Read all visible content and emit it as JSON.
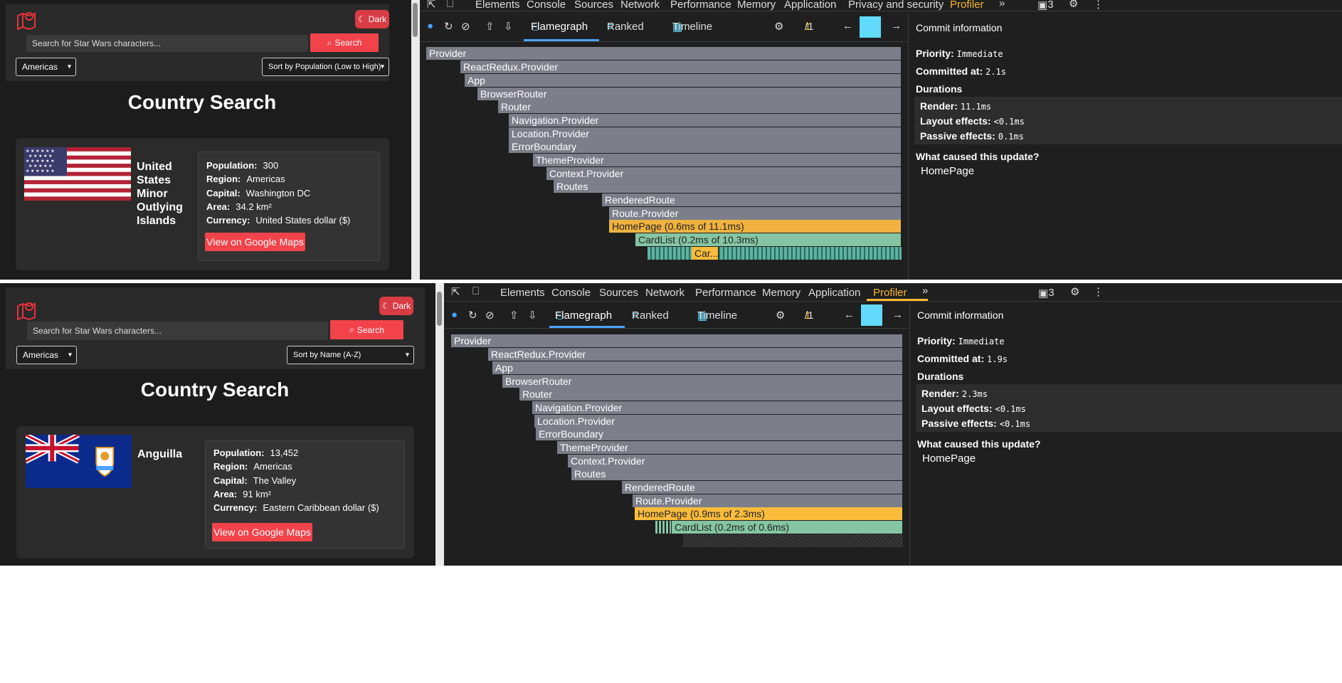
{
  "shots": [
    {
      "app": {
        "dark_label": "Dark",
        "search_placeholder": "Search for Star Wars characters...",
        "search_label": "Search",
        "region_value": "Americas",
        "sort_value": "Sort by Population (Low to High)",
        "title": "Country Search",
        "country": {
          "name": "United States Minor Outlying Islands",
          "name_lines": [
            "United",
            "States",
            "Minor",
            "Outlying",
            "Islands"
          ],
          "flag": "us-flag",
          "fields": [
            {
              "label": "Population:",
              "value": "300"
            },
            {
              "label": "Region:",
              "value": "Americas"
            },
            {
              "label": "Capital:",
              "value": "Washington DC"
            },
            {
              "label": "Area:",
              "value": "34.2 km²"
            },
            {
              "label": "Currency:",
              "value": "United States dollar ($)"
            }
          ],
          "maps_label": "View on Google Maps"
        }
      },
      "devtools": {
        "tabs": [
          "Elements",
          "Console",
          "Sources",
          "Network",
          "Performance",
          "Memory",
          "Application",
          "Privacy and security",
          "Profiler"
        ],
        "active_tab": "Profiler",
        "badge_count": "3",
        "views": [
          "Flamegraph",
          "Ranked",
          "Timeline"
        ],
        "commit_index": "1",
        "commit_total": "1",
        "flame": [
          {
            "label": "Provider"
          },
          {
            "label": "ReactRedux.Provider"
          },
          {
            "label": "App"
          },
          {
            "label": "BrowserRouter"
          },
          {
            "label": "Router"
          },
          {
            "label": "Navigation.Provider"
          },
          {
            "label": "Location.Provider"
          },
          {
            "label": "ErrorBoundary"
          },
          {
            "label": "ThemeProvider"
          },
          {
            "label": "Context.Provider"
          },
          {
            "label": "Routes"
          },
          {
            "label": "RenderedRoute"
          },
          {
            "label": "Route.Provider"
          },
          {
            "label": "HomePage (0.6ms of 11.1ms)"
          },
          {
            "label": "CardList (0.2ms of 10.3ms)"
          },
          {
            "label": "Car..."
          }
        ],
        "commit": {
          "heading": "Commit information",
          "priority_label": "Priority:",
          "priority": "Immediate",
          "committed_label": "Committed at:",
          "committed_at": "2.1s",
          "durations_label": "Durations",
          "render_label": "Render:",
          "render": "11.1ms",
          "layout_label": "Layout effects:",
          "layout": "<0.1ms",
          "passive_label": "Passive effects:",
          "passive": "0.1ms",
          "cause_label": "What caused this update?",
          "cause": "HomePage"
        }
      }
    },
    {
      "app": {
        "dark_label": "Dark",
        "search_placeholder": "Search for Star Wars characters...",
        "search_label": "Search",
        "region_value": "Americas",
        "sort_value": "Sort by Name (A-Z)",
        "title": "Country Search",
        "country": {
          "name": "Anguilla",
          "name_lines": [
            "Anguilla"
          ],
          "flag": "anguilla-flag",
          "fields": [
            {
              "label": "Population:",
              "value": "13,452"
            },
            {
              "label": "Region:",
              "value": "Americas"
            },
            {
              "label": "Capital:",
              "value": "The Valley"
            },
            {
              "label": "Area:",
              "value": "91 km²"
            },
            {
              "label": "Currency:",
              "value": "Eastern Caribbean dollar ($)"
            }
          ],
          "maps_label": "View on Google Maps"
        }
      },
      "devtools": {
        "tabs": [
          "Elements",
          "Console",
          "Sources",
          "Network",
          "Performance",
          "Memory",
          "Application",
          "Profiler"
        ],
        "active_tab": "Profiler",
        "badge_count": "3",
        "views": [
          "Flamegraph",
          "Ranked",
          "Timeline"
        ],
        "commit_index": "1",
        "commit_total": "1",
        "flame": [
          {
            "label": "Provider"
          },
          {
            "label": "ReactRedux.Provider"
          },
          {
            "label": "App"
          },
          {
            "label": "BrowserRouter"
          },
          {
            "label": "Router"
          },
          {
            "label": "Navigation.Provider"
          },
          {
            "label": "Location.Provider"
          },
          {
            "label": "ErrorBoundary"
          },
          {
            "label": "ThemeProvider"
          },
          {
            "label": "Context.Provider"
          },
          {
            "label": "Routes"
          },
          {
            "label": "RenderedRoute"
          },
          {
            "label": "Route.Provider"
          },
          {
            "label": "HomePage (0.9ms of 2.3ms)"
          },
          {
            "label": "CardList (0.2ms of 0.6ms)"
          }
        ],
        "commit": {
          "heading": "Commit information",
          "priority_label": "Priority:",
          "priority": "Immediate",
          "committed_label": "Committed at:",
          "committed_at": "1.9s",
          "durations_label": "Durations",
          "render_label": "Render:",
          "render": "2.3ms",
          "layout_label": "Layout effects:",
          "layout": "<0.1ms",
          "passive_label": "Passive effects:",
          "passive": "<0.1ms",
          "cause_label": "What caused this update?",
          "cause": "HomePage"
        }
      }
    }
  ],
  "colors": {
    "accent": "#f2434b",
    "profiler_tab": "#f7b731",
    "flame_gray": "#7c7f8a",
    "flame_hot": "#f0b33f",
    "flame_green": "#85c5a3",
    "commit_bar": "#61dafb"
  }
}
